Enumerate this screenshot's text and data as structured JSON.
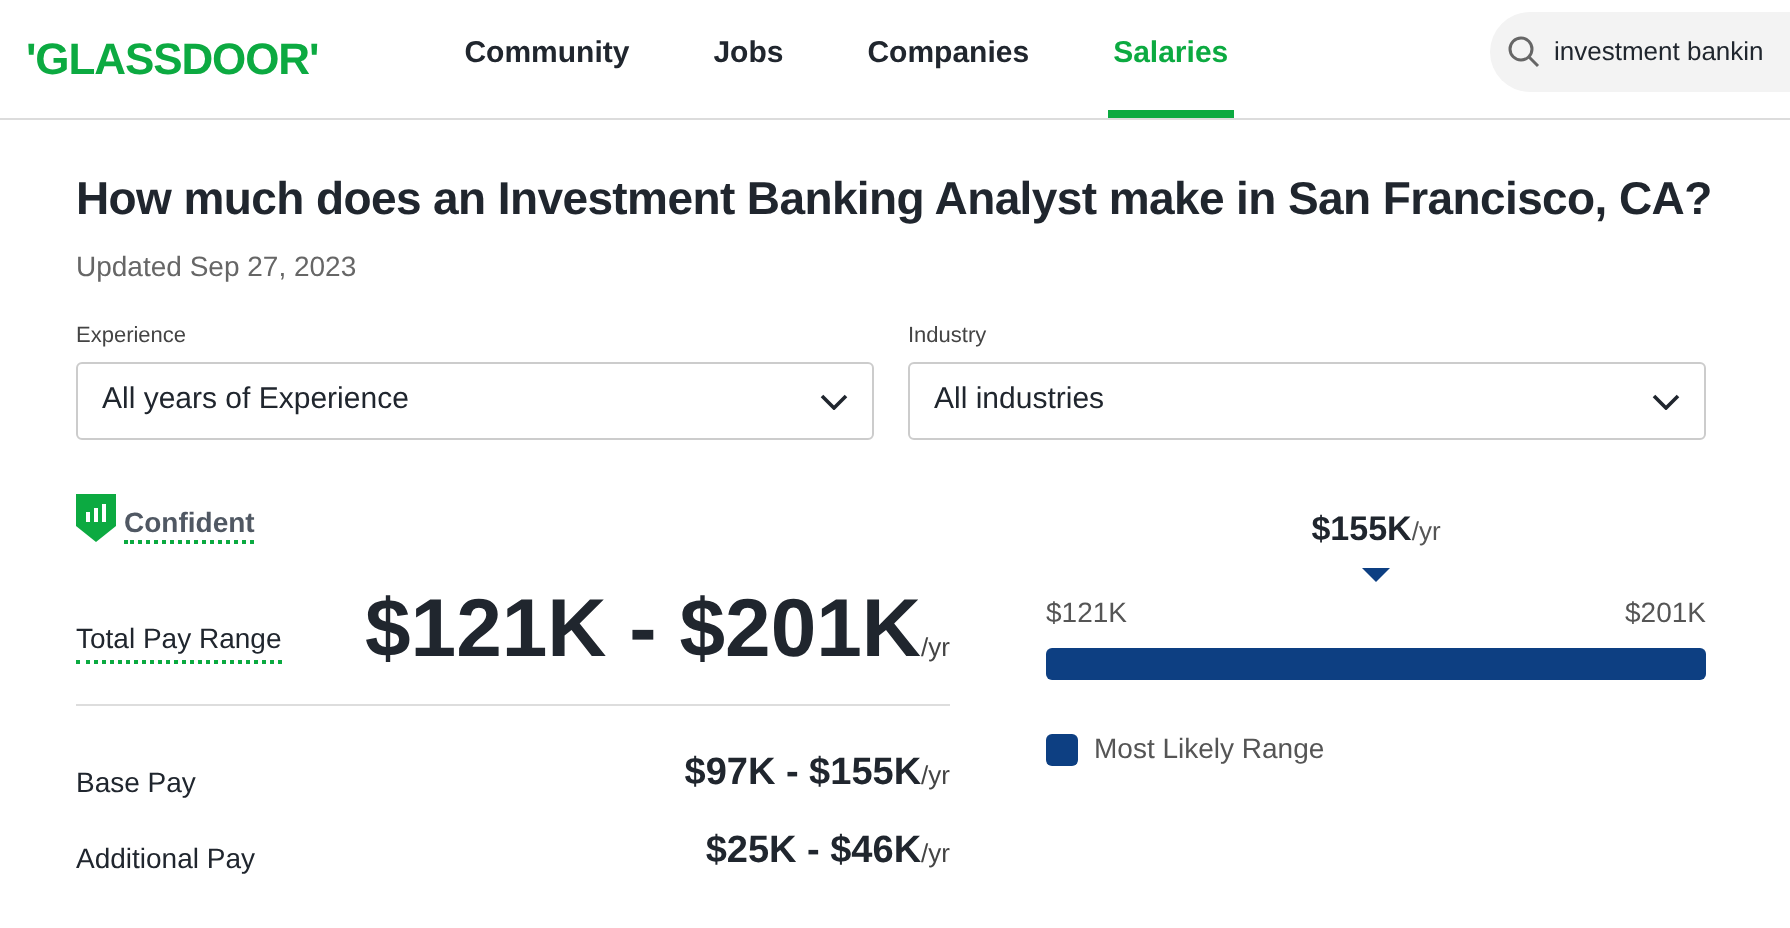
{
  "header": {
    "logo": "'GLASSDOOR'",
    "nav": [
      {
        "label": "Community",
        "selected": false
      },
      {
        "label": "Jobs",
        "selected": false
      },
      {
        "label": "Companies",
        "selected": false
      },
      {
        "label": "Salaries",
        "selected": true
      }
    ],
    "search": {
      "value": "investment bankin"
    }
  },
  "title": "How much does an Investment Banking Analyst make in San Francisco, CA?",
  "updated": "Updated Sep 27, 2023",
  "filters": [
    {
      "label": "Experience",
      "value": "All years of Experience"
    },
    {
      "label": "Industry",
      "value": "All industries"
    }
  ],
  "confidence": "Confident",
  "total": {
    "label": "Total Pay Range",
    "value": "$121K - $201K",
    "unit": "/yr"
  },
  "breakdown": [
    {
      "label": "Base Pay",
      "value": "$97K - $155K",
      "unit": "/yr"
    },
    {
      "label": "Additional Pay",
      "value": "$25K - $46K",
      "unit": "/yr"
    }
  ],
  "range": {
    "median": "$155K",
    "median_unit": "/yr",
    "low": "$121K",
    "high": "$201K",
    "legend": "Most Likely Range"
  }
}
